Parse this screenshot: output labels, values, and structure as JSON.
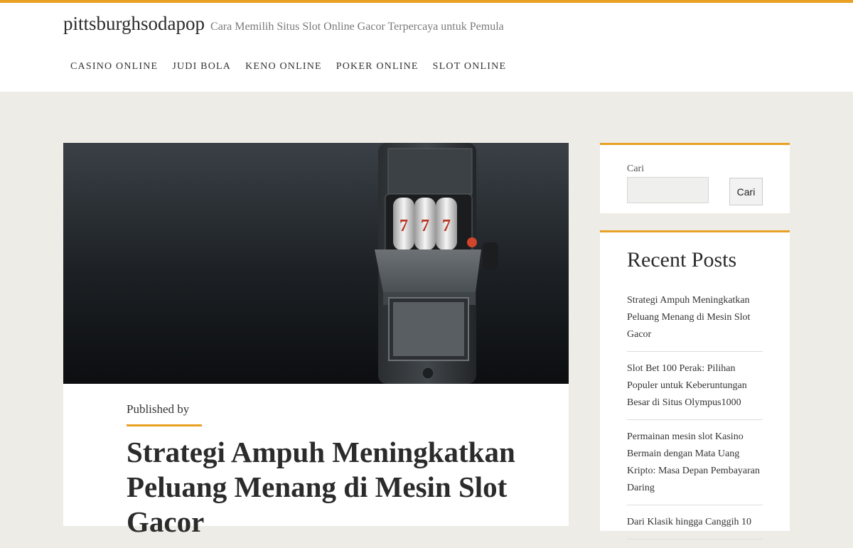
{
  "site": {
    "title": "pittsburghsodapop",
    "tagline": "Cara Memilih Situs Slot Online Gacor Terpercaya untuk Pemula"
  },
  "nav": {
    "items": [
      "CASINO ONLINE",
      "JUDI BOLA",
      "KENO ONLINE",
      "POKER ONLINE",
      "SLOT ONLINE"
    ]
  },
  "hero": {
    "reels": [
      "7",
      "7",
      "7"
    ]
  },
  "post": {
    "byline": "Published by",
    "title": "Strategi Ampuh Meningkatkan Peluang Menang di Mesin Slot Gacor"
  },
  "search": {
    "label": "Cari",
    "placeholder": "",
    "button": "Cari"
  },
  "recent": {
    "heading": "Recent Posts",
    "items": [
      "Strategi Ampuh Meningkatkan Peluang Menang di Mesin Slot Gacor",
      "Slot Bet 100 Perak: Pilihan Populer untuk Keberuntungan Besar di Situs Olympus1000",
      "Permainan mesin slot Kasino Bermain dengan Mata Uang Kripto: Masa Depan Pembayaran Daring",
      "Dari Klasik hingga Canggih 10"
    ]
  },
  "colors": {
    "accent": "#e8a123",
    "page_bg": "#edece6",
    "reel_digit": "#b8321e"
  }
}
